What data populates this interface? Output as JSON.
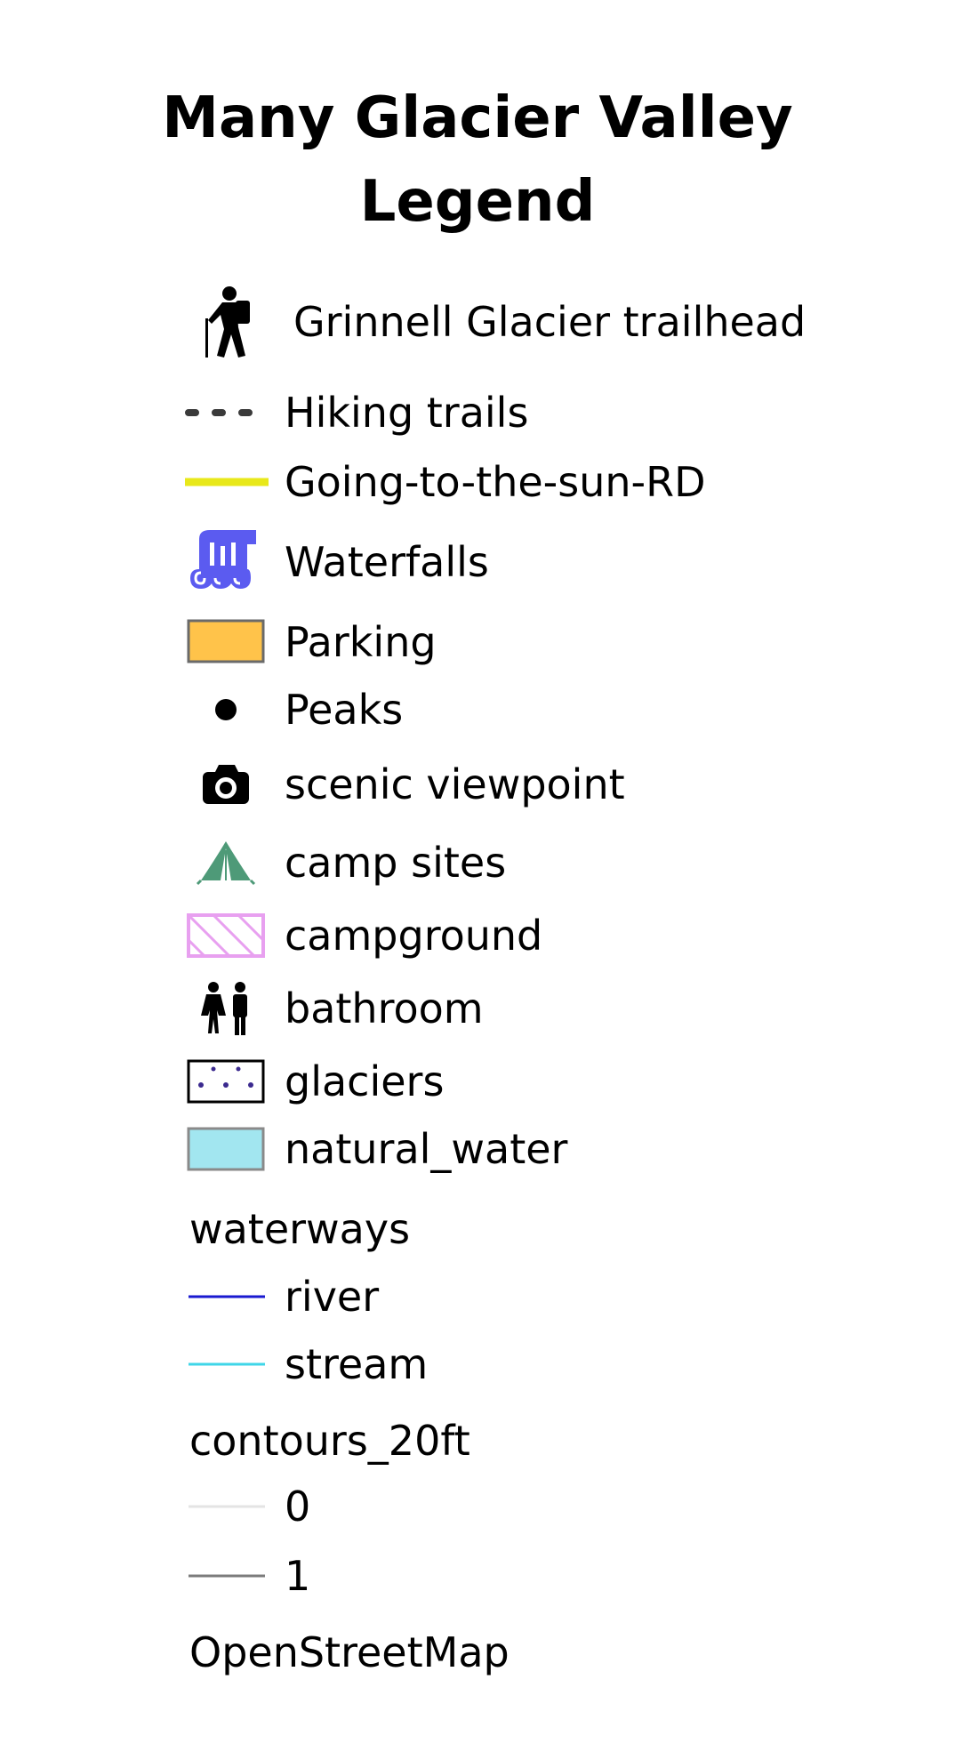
{
  "legend": {
    "title_line1": "Many Glacier Valley",
    "title_line2": "Legend",
    "items": [
      {
        "label": "Grinnell Glacier trailhead",
        "icon": "hiker-icon"
      },
      {
        "label": "Hiking trails",
        "icon": "dashed-line-icon",
        "color": "#3a3a3a"
      },
      {
        "label": "Going-to-the-sun-RD",
        "icon": "road-line-icon",
        "color": "#e8e81a"
      },
      {
        "label": "Waterfalls",
        "icon": "waterfall-icon",
        "color": "#5b5bf0"
      },
      {
        "label": "Parking",
        "icon": "parking-fill-icon",
        "color": "#ffc34a"
      },
      {
        "label": "Peaks",
        "icon": "peak-dot-icon",
        "color": "#000000"
      },
      {
        "label": "scenic viewpoint",
        "icon": "camera-icon",
        "color": "#000000"
      },
      {
        "label": "camp sites",
        "icon": "tent-icon",
        "color": "#4e9a78"
      },
      {
        "label": "campground",
        "icon": "hatched-area-icon",
        "color": "#e8a0f0"
      },
      {
        "label": "bathroom",
        "icon": "restroom-icon",
        "color": "#000000"
      },
      {
        "label": "glaciers",
        "icon": "glacier-pattern-icon",
        "color": "#3b2a8f"
      },
      {
        "label": "natural_water",
        "icon": "water-fill-icon",
        "color": "#a2e6f0"
      }
    ],
    "waterways": {
      "heading": "waterways",
      "items": [
        {
          "label": "river",
          "icon": "river-line-icon",
          "color": "#1a1ad0"
        },
        {
          "label": "stream",
          "icon": "stream-line-icon",
          "color": "#3fd6e8"
        }
      ]
    },
    "contours": {
      "heading": "contours_20ft",
      "items": [
        {
          "label": "0",
          "icon": "contour-line-icon",
          "color": "#e4e4e4"
        },
        {
          "label": "1",
          "icon": "contour-line-icon",
          "color": "#7c7c7c"
        }
      ]
    },
    "basemap_label": "OpenStreetMap"
  }
}
